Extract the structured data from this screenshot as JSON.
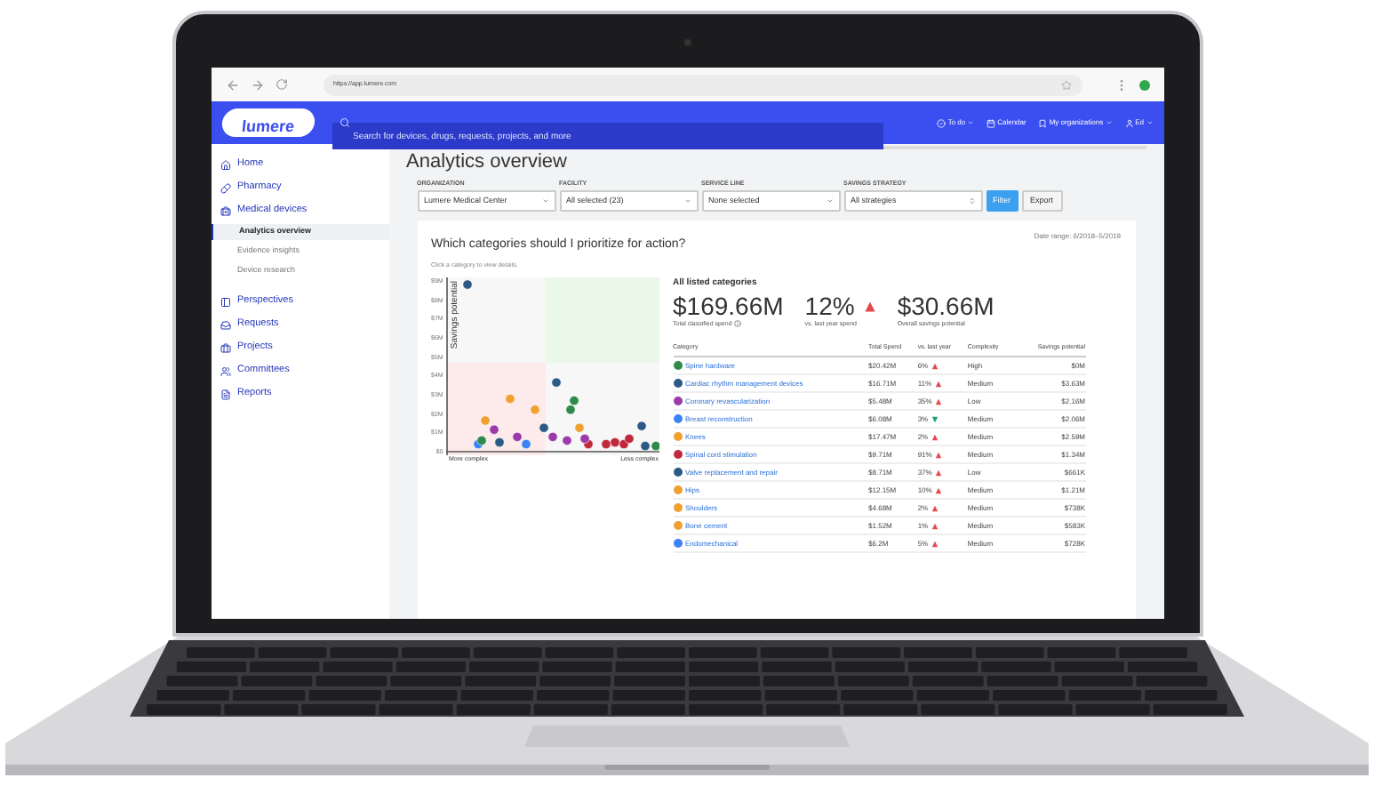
{
  "browser": {
    "url": "https://app.lumere.com"
  },
  "header": {
    "logo": "lumere",
    "search_placeholder": "Search for devices, drugs, requests, projects, and more",
    "links": [
      {
        "label": "To do",
        "kind": "todo"
      },
      {
        "label": "Calendar",
        "kind": "calendar"
      },
      {
        "label": "My organizations",
        "kind": "orgs"
      },
      {
        "label": "Ed",
        "kind": "user"
      }
    ]
  },
  "sidebar": {
    "items": [
      {
        "label": "Home",
        "selected": false
      },
      {
        "label": "Pharmacy",
        "selected": false
      },
      {
        "label": "Medical devices",
        "selected": false,
        "children": [
          {
            "label": "Analytics overview",
            "selected": true
          },
          {
            "label": "Evidence insights",
            "selected": false
          },
          {
            "label": "Device research",
            "selected": false
          }
        ]
      },
      {
        "label": "Perspectives",
        "selected": false
      },
      {
        "label": "Requests",
        "selected": false
      },
      {
        "label": "Projects",
        "selected": false
      },
      {
        "label": "Committees",
        "selected": false
      },
      {
        "label": "Reports",
        "selected": false
      }
    ]
  },
  "page": {
    "title": "Analytics overview",
    "filters": [
      {
        "label": "ORGANIZATION",
        "value": "Lumere Medical Center",
        "kind": "dropdown"
      },
      {
        "label": "FACILITY",
        "value": "All selected (23)",
        "kind": "dropdown"
      },
      {
        "label": "SERVICE LINE",
        "value": "None selected",
        "kind": "dropdown"
      },
      {
        "label": "SAVINGS STRATEGY",
        "value": "All strategies",
        "kind": "select"
      }
    ],
    "buttons": [
      {
        "label": "Filter",
        "kind": "primary"
      },
      {
        "label": "Export",
        "kind": "secondary"
      }
    ],
    "card": {
      "question": "Which categories should I prioritize for action?",
      "date_range": "Date range: 6/2018–5/2019",
      "hint": "Click a category to view details.",
      "scatter": {
        "y_tick_labels": [
          "$9M",
          "$8M",
          "$7M",
          "$6M",
          "$5M",
          "$4M",
          "$3M",
          "$2M",
          "$1M",
          "$0"
        ],
        "y_label": "Savings potential",
        "x_left_label": "More complex",
        "x_right_label": "Less complex"
      },
      "summary_title": "All listed categories",
      "stats": [
        {
          "value": "$169.66M",
          "label": "Total classified spend",
          "info": true
        },
        {
          "value": "12%",
          "label": "vs. last year spend",
          "rising": true
        },
        {
          "value": "$30.66M",
          "label": "Overall savings potential"
        }
      ],
      "table": {
        "columns": [
          "Category",
          "Total Spend",
          "vs. last year",
          "Complexity",
          "Savings potential"
        ],
        "rows": [
          {
            "category": "Spine hardware",
            "color": "#2e8b4a",
            "spend": "$20.42M",
            "change": "6%",
            "rising": true,
            "complexity": "High",
            "savings": "$0M"
          },
          {
            "category": "Cardiac rhythm management devices",
            "color": "#2c5a85",
            "spend": "$16.71M",
            "change": "11%",
            "rising": true,
            "complexity": "Medium",
            "savings": "$3.63M"
          },
          {
            "category": "Coronary revascularization",
            "color": "#9b3aa8",
            "spend": "$5.48M",
            "change": "35%",
            "rising": true,
            "complexity": "Low",
            "savings": "$2.16M"
          },
          {
            "category": "Breast reconstruction",
            "color": "#3b82f6",
            "spend": "$6.08M",
            "change": "3%",
            "rising": false,
            "complexity": "Medium",
            "savings": "$2.06M"
          },
          {
            "category": "Knees",
            "color": "#f0a030",
            "spend": "$17.47M",
            "change": "2%",
            "rising": true,
            "complexity": "Medium",
            "savings": "$2.59M"
          },
          {
            "category": "Spinal cord stimulation",
            "color": "#c0283c",
            "spend": "$9.71M",
            "change": "91%",
            "rising": true,
            "complexity": "Medium",
            "savings": "$1.34M"
          },
          {
            "category": "Valve replacement and repair",
            "color": "#2c5a85",
            "spend": "$8.71M",
            "change": "37%",
            "rising": true,
            "complexity": "Low",
            "savings": "$661K"
          },
          {
            "category": "Hips",
            "color": "#f0a030",
            "spend": "$12.15M",
            "change": "10%",
            "rising": true,
            "complexity": "Medium",
            "savings": "$1.21M"
          },
          {
            "category": "Shoulders",
            "color": "#f0a030",
            "spend": "$4.68M",
            "change": "2%",
            "rising": true,
            "complexity": "Medium",
            "savings": "$738K"
          },
          {
            "category": "Bone cement",
            "color": "#f0a030",
            "spend": "$1.52M",
            "change": "1%",
            "rising": true,
            "complexity": "Medium",
            "savings": "$583K"
          },
          {
            "category": "Endomechanical",
            "color": "#3b82f6",
            "spend": "$6.2M",
            "change": "5%",
            "rising": true,
            "complexity": "Medium",
            "savings": "$728K"
          }
        ]
      }
    }
  }
}
